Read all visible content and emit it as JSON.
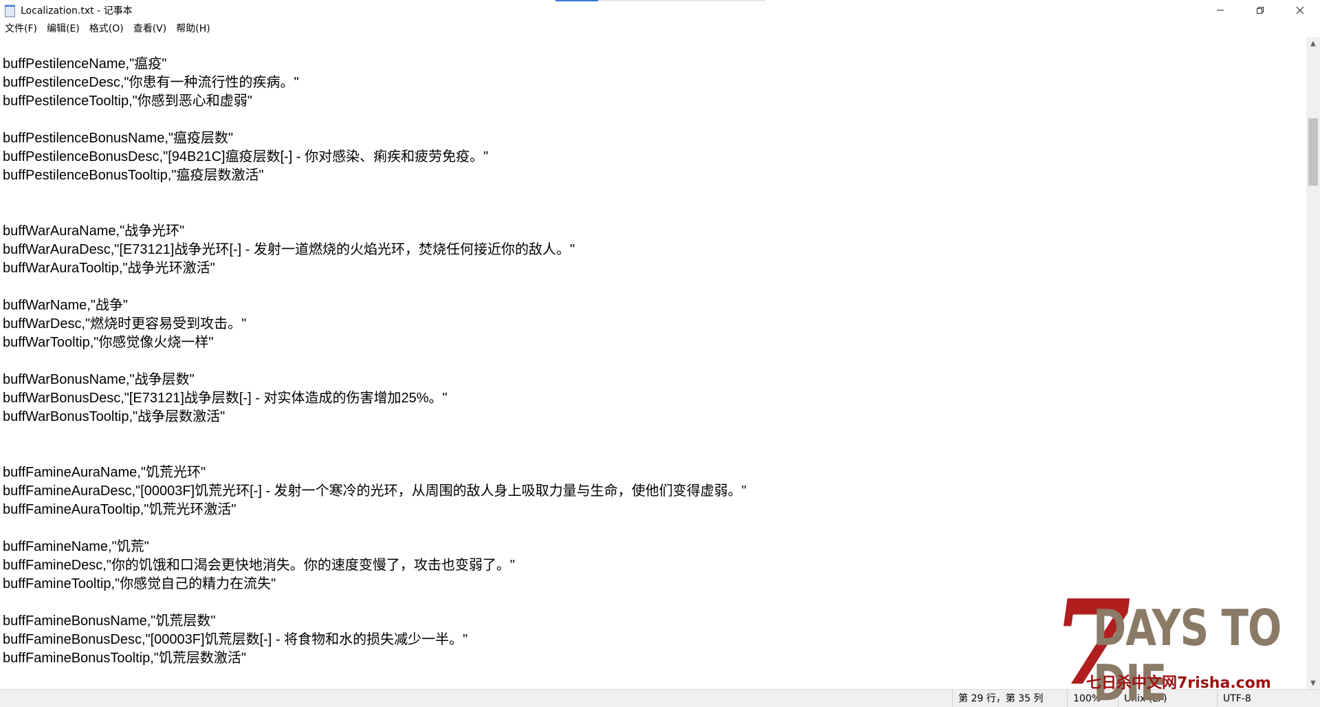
{
  "window": {
    "title": "Localization.txt - 记事本",
    "controls": {
      "minimize": "—",
      "restore": "❐",
      "close": "✕"
    }
  },
  "menu": [
    "文件(F)",
    "编辑(E)",
    "格式(O)",
    "查看(V)",
    "帮助(H)"
  ],
  "editor": {
    "lines": [
      "buffPestilenceName,\"瘟疫\"",
      "buffPestilenceDesc,\"你患有一种流行性的疾病。\"",
      "buffPestilenceTooltip,\"你感到恶心和虚弱\"",
      "",
      "buffPestilenceBonusName,\"瘟疫层数\"",
      "buffPestilenceBonusDesc,\"[94B21C]瘟疫层数[-] - 你对感染、痢疾和疲劳免疫。\"",
      "buffPestilenceBonusTooltip,\"瘟疫层数激活\"",
      "",
      "",
      "buffWarAuraName,\"战争光环\"",
      "buffWarAuraDesc,\"[E73121]战争光环[-] - 发射一道燃烧的火焰光环，焚烧任何接近你的敌人。\"",
      "buffWarAuraTooltip,\"战争光环激活\"",
      "",
      "buffWarName,\"战争\"",
      "buffWarDesc,\"燃烧时更容易受到攻击。\"",
      "buffWarTooltip,\"你感觉像火烧一样\"",
      "",
      "buffWarBonusName,\"战争层数\"",
      "buffWarBonusDesc,\"[E73121]战争层数[-] - 对实体造成的伤害增加25%。\"",
      "buffWarBonusTooltip,\"战争层数激活\"",
      "",
      "",
      "buffFamineAuraName,\"饥荒光环\"",
      "buffFamineAuraDesc,\"[00003F]饥荒光环[-] - 发射一个寒冷的光环，从周围的敌人身上吸取力量与生命，使他们变得虚弱。\"",
      "buffFamineAuraTooltip,\"饥荒光环激活\"",
      "",
      "buffFamineName,\"饥荒\"",
      "buffFamineDesc,\"你的饥饿和口渴会更快地消失。你的速度变慢了，攻击也变弱了。\"",
      "buffFamineTooltip,\"你感觉自己的精力在流失\"",
      "",
      "buffFamineBonusName,\"饥荒层数\"",
      "buffFamineBonusDesc,\"[00003F]饥荒层数[-] - 将食物和水的损失减少一半。\"",
      "buffFamineBonusTooltip,\"饥荒层数激活\""
    ]
  },
  "status": {
    "position": "第 29 行，第 35 列",
    "zoom": "100%",
    "line_ending": "Unix (LF)",
    "encoding": "UTF-8"
  },
  "watermark": {
    "seven": "7",
    "title": "DAYS TO DIE",
    "subtitle": "七日杀中文网7risha.com"
  }
}
